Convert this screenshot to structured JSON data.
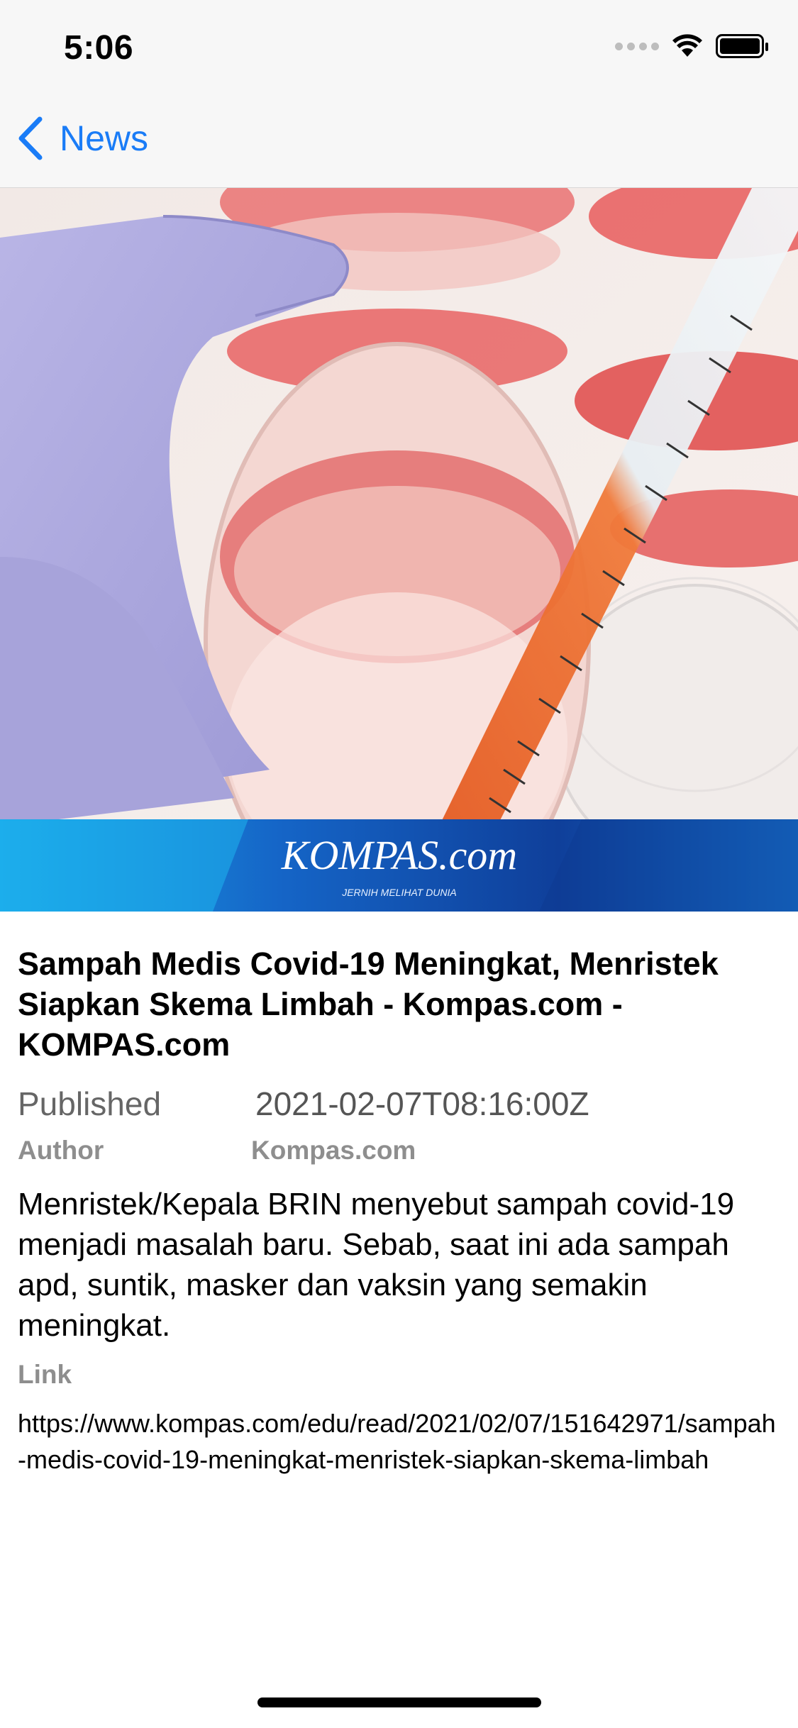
{
  "status_bar": {
    "time": "5:06"
  },
  "nav": {
    "back_label": "News"
  },
  "hero": {
    "brand": "KOMPAS.com",
    "tagline": "JERNIH MELIHAT DUNIA",
    "banner_color": "#1456b8"
  },
  "article": {
    "title": "Sampah Medis Covid-19 Meningkat, Menristek Siapkan Skema Limbah - Kompas.com - KOMPAS.com",
    "published_label": "Published",
    "published_value": "2021-02-07T08:16:00Z",
    "author_label": "Author",
    "author_value": "Kompas.com",
    "description": "Menristek/Kepala BRIN menyebut sampah covid-19 menjadi masalah baru. Sebab, saat ini ada sampah apd, suntik, masker dan vaksin yang semakin meningkat.",
    "link_label": "Link",
    "link_url": "https://www.kompas.com/edu/read/2021/02/07/151642971/sampah-medis-covid-19-meningkat-menristek-siapkan-skema-limbah"
  },
  "colors": {
    "accent": "#1a7cf7"
  }
}
